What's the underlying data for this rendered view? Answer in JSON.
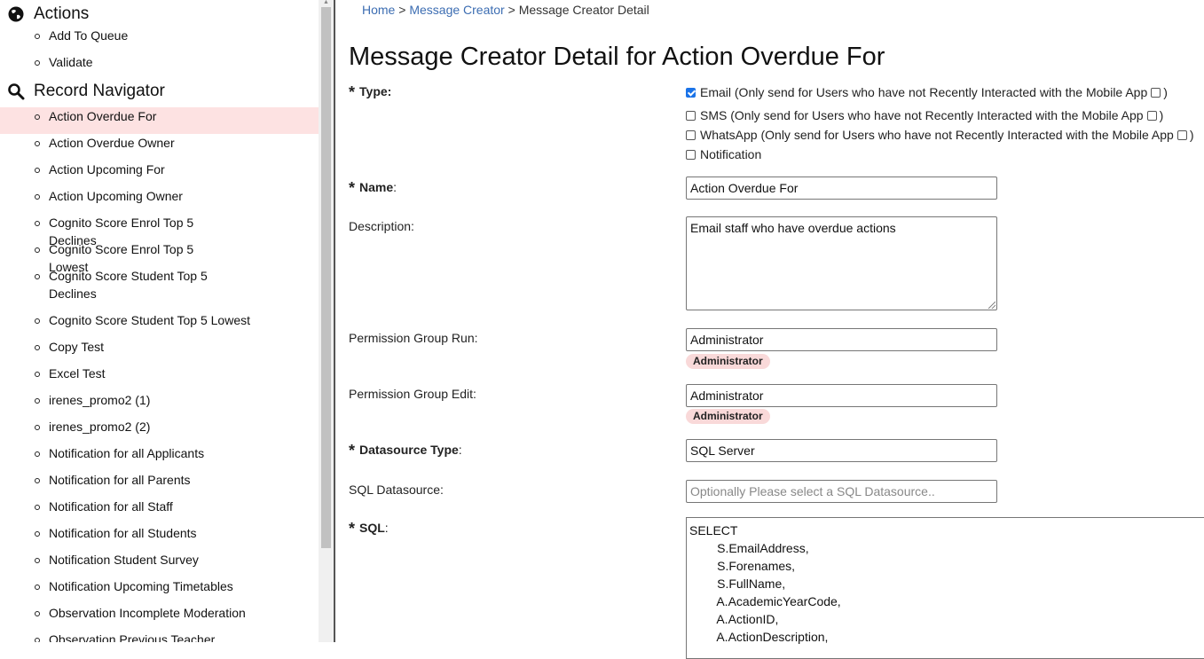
{
  "sidebar": {
    "actions_title": "Actions",
    "actions": [
      "Add To Queue",
      "Validate"
    ],
    "navigator_title": "Record Navigator",
    "items": [
      {
        "label": "Action Overdue For",
        "active": true
      },
      {
        "label": "Action Overdue Owner"
      },
      {
        "label": "Action Upcoming For"
      },
      {
        "label": "Action Upcoming Owner"
      },
      {
        "label": "Cognito Score Enrol Top 5 Declines"
      },
      {
        "label": "Cognito Score Enrol Top 5 Lowest"
      },
      {
        "label": "Cognito Score Student Top 5 Declines"
      },
      {
        "label": "Cognito Score Student Top 5 Lowest"
      },
      {
        "label": "Copy Test"
      },
      {
        "label": "Excel Test"
      },
      {
        "label": "irenes_promo2 (1)"
      },
      {
        "label": "irenes_promo2 (2)"
      },
      {
        "label": "Notification for all Applicants"
      },
      {
        "label": "Notification for all Parents"
      },
      {
        "label": "Notification for all Staff"
      },
      {
        "label": "Notification for all Students"
      },
      {
        "label": "Notification Student Survey"
      },
      {
        "label": "Notification Upcoming Timetables"
      },
      {
        "label": "Observation Incomplete Moderation"
      },
      {
        "label": "Observation Previous Teacher"
      }
    ]
  },
  "breadcrumb": {
    "home": "Home",
    "sep1": " > ",
    "message_creator": "Message Creator",
    "sep2": " > ",
    "current": "Message Creator Detail"
  },
  "page_title": "Message Creator Detail for Action Overdue For",
  "form": {
    "type_label": "Type:",
    "types": [
      {
        "label": "Email (Only send for Users who have not Recently Interacted with the Mobile App",
        "checked": true,
        "suffix": ")"
      },
      {
        "label": "SMS (Only send for Users who have not Recently Interacted with the Mobile App",
        "checked": false,
        "suffix": ")"
      },
      {
        "label": "WhatsApp (Only send for Users who have not Recently Interacted with the Mobile App",
        "checked": false,
        "suffix": ")"
      },
      {
        "label": "Notification",
        "checked": false
      }
    ],
    "name_label": "Name",
    "name_value": "Action Overdue For",
    "description_label": "Description:",
    "description_value": "Email staff who have overdue actions",
    "perm_run_label": "Permission Group Run:",
    "perm_run_value": "Administrator",
    "perm_run_tag": "Administrator",
    "perm_edit_label": "Permission Group Edit:",
    "perm_edit_value": "Administrator",
    "perm_edit_tag": "Administrator",
    "ds_type_label": "Datasource Type",
    "ds_type_value": "SQL Server",
    "sql_ds_label": "SQL Datasource:",
    "sql_ds_placeholder": "Optionally Please select a SQL Datasource..",
    "sql_label": "SQL",
    "sql_lines": [
      "SELECT",
      "        S.EmailAddress,",
      "        S.Forenames,",
      "        S.FullName,",
      "        A.AcademicYearCode,",
      "        A.ActionID,",
      "        A.ActionDescription,"
    ]
  }
}
